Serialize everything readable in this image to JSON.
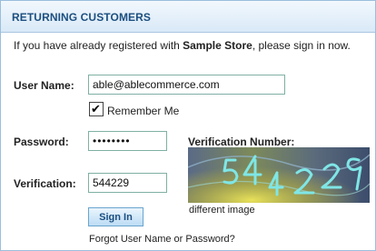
{
  "header": {
    "title": "RETURNING CUSTOMERS"
  },
  "intro": {
    "before": "If you have already registered with ",
    "store_name": "Sample Store",
    "after": ", please sign in now."
  },
  "form": {
    "username_label": "User Name:",
    "username_value": "able@ablecommerce.com",
    "remember_label": "Remember Me",
    "remember_checked": true,
    "password_label": "Password:",
    "password_value": "••••••••",
    "verification_label": "Verification:",
    "verification_value": "544229",
    "verification_number_label": "Verification Number:",
    "captcha_text": "544229",
    "different_image_link": "different image",
    "signin_label": "Sign In",
    "forgot_link": "Forgot User Name or Password?"
  },
  "colors": {
    "header_text": "#1c4f80",
    "panel_border": "#9bbedc",
    "field_border": "#7fb0a4",
    "captcha_glyph": "#7fe6e6"
  }
}
